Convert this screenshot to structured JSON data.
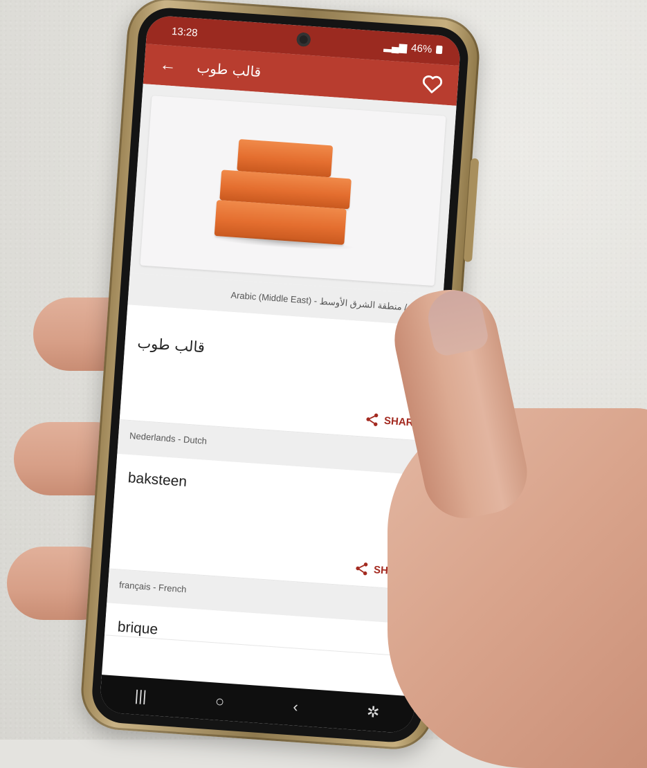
{
  "status": {
    "time": "13:28",
    "battery": "46%"
  },
  "appbar": {
    "title": "قالب طوب"
  },
  "locale_caption": "Arabic (Middle East) - العربية / منطقة الشرق الأوسط",
  "entries": [
    {
      "word": "قالب طوب",
      "share_label": "SHARE"
    },
    {
      "section": "Nederlands - Dutch",
      "word": "baksteen",
      "share_label": "SHARE"
    },
    {
      "section": "français - French",
      "word": "brique"
    }
  ],
  "colors": {
    "statusbar": "#9b2a20",
    "appbar": "#b83d2f",
    "accent": "#a32a20"
  },
  "icons": [
    "back-arrow-icon",
    "heart-icon",
    "speaker-icon",
    "share-icon"
  ]
}
